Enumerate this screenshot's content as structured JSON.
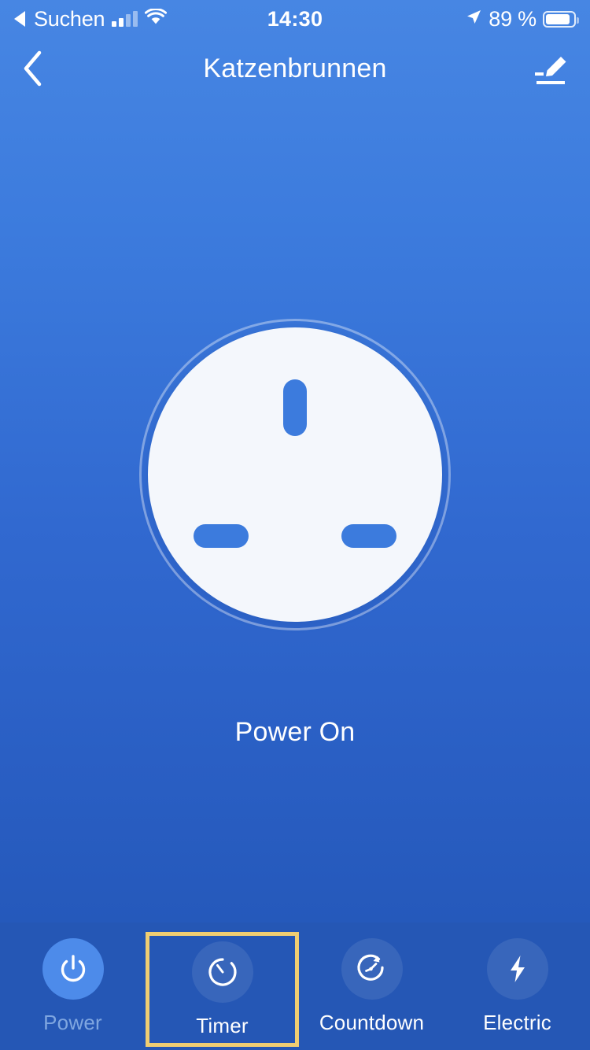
{
  "status_bar": {
    "carrier_back_label": "Suchen",
    "back_arrow_icon": "triangle-left-icon",
    "signal_icon": "cellular-signal-icon",
    "signal_bars_filled": 2,
    "signal_bars_total": 4,
    "wifi_icon": "wifi-icon",
    "time": "14:30",
    "location_icon": "location-arrow-icon",
    "battery_percent": "89 %",
    "battery_icon": "battery-icon",
    "battery_level": 89
  },
  "nav_bar": {
    "back_icon": "chevron-left-icon",
    "title": "Katzenbrunnen",
    "edit_icon": "edit-pencil-icon"
  },
  "device": {
    "socket_icon": "uk-power-socket-icon",
    "status_text": "Power On",
    "state": "on"
  },
  "tab_bar": {
    "items": [
      {
        "id": "power",
        "label": "Power",
        "icon": "power-icon",
        "selected": false,
        "dimmed": true
      },
      {
        "id": "timer",
        "label": "Timer",
        "icon": "timer-icon",
        "selected": true,
        "dimmed": false
      },
      {
        "id": "countdown",
        "label": "Countdown",
        "icon": "countdown-icon",
        "selected": false,
        "dimmed": false
      },
      {
        "id": "electric",
        "label": "Electric",
        "icon": "lightning-bolt-icon",
        "selected": false,
        "dimmed": false
      }
    ]
  },
  "colors": {
    "bg_top": "#4786E3",
    "bg_bottom": "#2154B4",
    "tabbar_bg": "#2557B5",
    "highlight_border": "#F0CE72",
    "socket_face": "#F4F7FC",
    "socket_pin": "#3C7BDD",
    "power_bubble": "#4D8BEA",
    "dim_label": "#7FA6E0"
  }
}
